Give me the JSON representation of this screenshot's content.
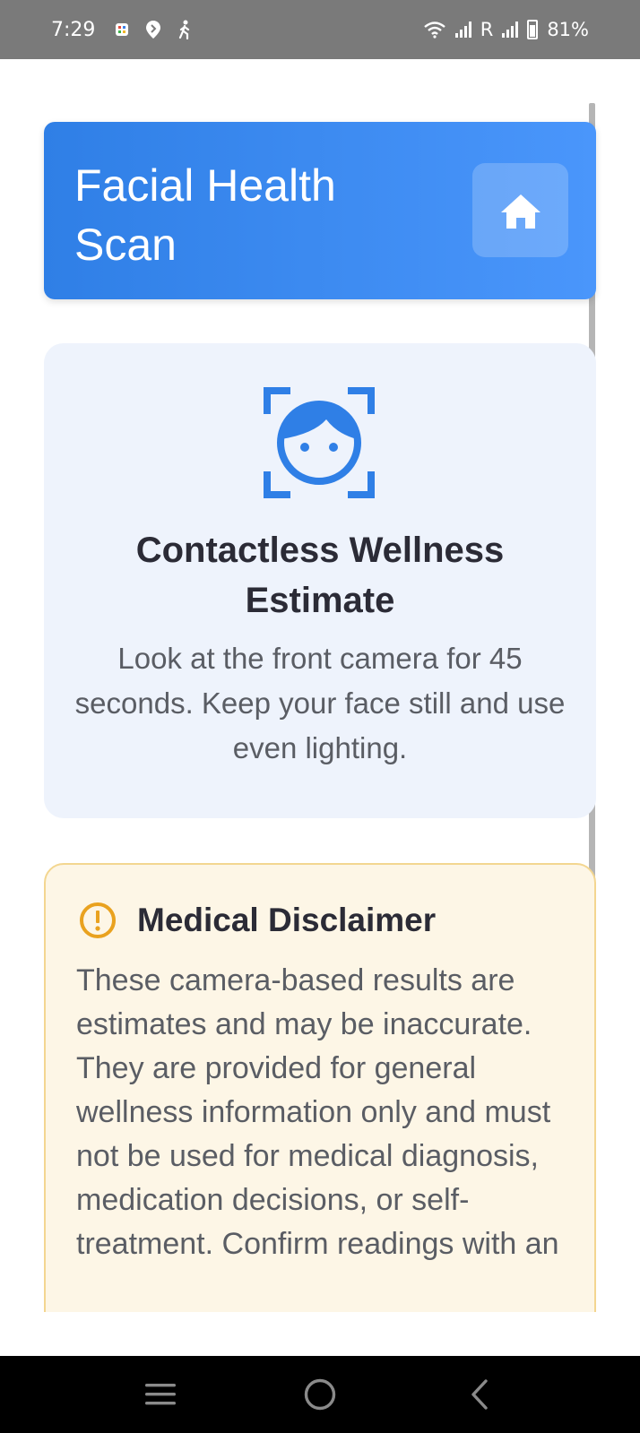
{
  "status_bar": {
    "time": "7:29",
    "roaming": "R",
    "battery": "81%",
    "notification_icons": [
      "app-notification-icon",
      "location-pin-icon",
      "walking-icon"
    ],
    "system_icons": [
      "wifi-icon",
      "signal-icon",
      "signal-icon",
      "battery-icon"
    ]
  },
  "header": {
    "title": "Facial Health Scan",
    "home_icon": "home-icon",
    "colors": {
      "start": "#2f7fe6",
      "end": "#4a96fb"
    }
  },
  "info_card": {
    "icon": "face-scan-icon",
    "title": "Contactless Wellness Estimate",
    "description": "Look at the front camera for 45 seconds. Keep your face still and use even lighting."
  },
  "disclaimer": {
    "icon": "warning-icon",
    "title": "Medical Disclaimer",
    "text": "These camera-based results are estimates and may be inaccurate. They are provided for general wellness information only and must not be used for medical diagnosis, medication decisions, or self-treatment. Confirm readings with an"
  },
  "nav_bar": {
    "icons": [
      "recent-apps-icon",
      "home-circle-icon",
      "back-icon"
    ]
  },
  "accent_color": "#2f7fe6",
  "warning_color": "#e9a21f"
}
